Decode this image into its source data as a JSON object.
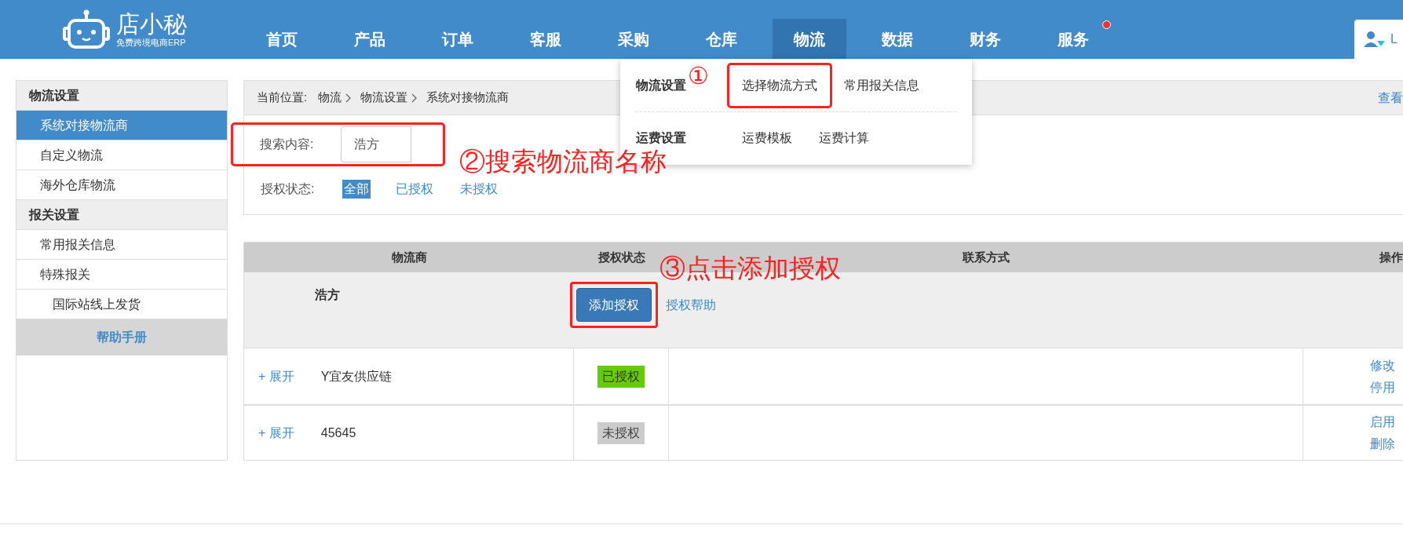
{
  "header": {
    "logo": {
      "name": "店小秘",
      "tagline": "免费跨境电商ERP"
    },
    "nav": [
      {
        "label": "首页",
        "selected": false,
        "badge": false
      },
      {
        "label": "产品",
        "selected": false,
        "badge": false
      },
      {
        "label": "订单",
        "selected": false,
        "badge": false
      },
      {
        "label": "客服",
        "selected": false,
        "badge": false
      },
      {
        "label": "采购",
        "selected": false,
        "badge": false
      },
      {
        "label": "仓库",
        "selected": false,
        "badge": false
      },
      {
        "label": "物流",
        "selected": true,
        "badge": false
      },
      {
        "label": "数据",
        "selected": false,
        "badge": false
      },
      {
        "label": "财务",
        "selected": false,
        "badge": false
      },
      {
        "label": "服务",
        "selected": false,
        "badge": true
      }
    ],
    "user": {
      "label": "L"
    }
  },
  "dropdown": {
    "groups": [
      {
        "title": "物流设置",
        "links": [
          {
            "label": "选择物流方式",
            "highlighted": true
          },
          {
            "label": "常用报关信息",
            "highlighted": false
          }
        ]
      },
      {
        "title": "运费设置",
        "links": [
          {
            "label": "运费模板",
            "highlighted": false
          },
          {
            "label": "运费计算",
            "highlighted": false
          }
        ]
      }
    ]
  },
  "sidebar": {
    "sections": [
      {
        "title": "物流设置",
        "items": [
          {
            "label": "系统对接物流商",
            "selected": true
          },
          {
            "label": "自定义物流",
            "selected": false
          },
          {
            "label": "海外仓库物流",
            "selected": false
          }
        ]
      },
      {
        "title": "报关设置",
        "items": [
          {
            "label": "常用报关信息",
            "selected": false
          },
          {
            "label": "特殊报关",
            "selected": false,
            "children": [
              {
                "label": "国际站线上发货",
                "selected": false
              }
            ]
          }
        ]
      }
    ],
    "help": "帮助手册"
  },
  "breadcrumb": {
    "label": "当前位置:",
    "path": [
      "物流",
      "物流设置",
      "系统对接物流商"
    ],
    "link": "查看"
  },
  "search": {
    "label": "搜索内容:",
    "value": "浩方",
    "highlighted": true
  },
  "status_filter": {
    "label": "授权状态:",
    "options": [
      {
        "label": "全部",
        "selected": true
      },
      {
        "label": "已授权",
        "selected": false
      },
      {
        "label": "未授权",
        "selected": false
      }
    ]
  },
  "table": {
    "columns": [
      "物流商",
      "授权状态",
      "联系方式",
      "操作"
    ],
    "result": {
      "name": "浩方",
      "button": "添加授权",
      "button_highlighted": true,
      "help_link": "授权帮助"
    },
    "rows": [
      {
        "expand": "+ 展开",
        "name": "Y宜友供应链",
        "status": "已授权",
        "authorized": true,
        "actions": [
          "修改",
          "停用"
        ]
      },
      {
        "expand": "+ 展开",
        "name": "45645",
        "status": "未授权",
        "authorized": false,
        "actions": [
          "启用",
          "删除"
        ]
      }
    ]
  },
  "annotations": {
    "step1": "①",
    "step2": "②搜索物流商名称",
    "step3": "③点击添加授权"
  }
}
